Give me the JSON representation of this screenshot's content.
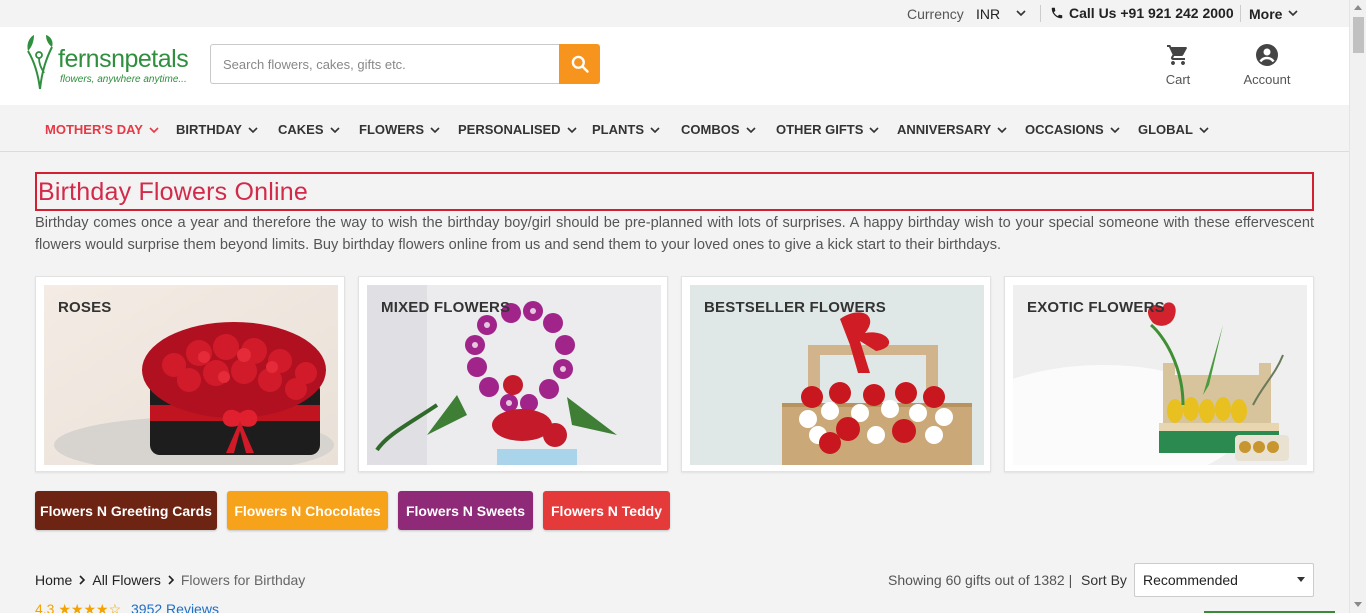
{
  "topbar": {
    "currency_label": "Currency",
    "currency_value": "INR",
    "call_label": "Call Us +91 921 242 2000",
    "more_label": "More"
  },
  "header": {
    "logo_text": "fernsnpetals",
    "logo_tagline": "flowers, anywhere anytime...",
    "search_placeholder": "Search flowers, cakes, gifts etc.",
    "cart_label": "Cart",
    "account_label": "Account",
    "search_icon": "search-icon",
    "cart_icon": "cart-icon",
    "account_icon": "account-icon"
  },
  "nav": {
    "items": [
      {
        "label": "MOTHER'S DAY",
        "active": true
      },
      {
        "label": "BIRTHDAY"
      },
      {
        "label": "CAKES"
      },
      {
        "label": "FLOWERS"
      },
      {
        "label": "PERSONALISED"
      },
      {
        "label": "PLANTS"
      },
      {
        "label": "COMBOS"
      },
      {
        "label": "OTHER GIFTS"
      },
      {
        "label": "ANNIVERSARY"
      },
      {
        "label": "OCCASIONS"
      },
      {
        "label": "GLOBAL"
      }
    ],
    "active_color": "#e53945"
  },
  "page": {
    "title": "Birthday Flowers Online",
    "description": "Birthday comes once a year and therefore the way to wish the birthday boy/girl should be pre-planned with lots of surprises. A happy birthday wish to your special someone with these effervescent flowers would surprise them beyond limits. Buy birthday flowers online from us and send them to your loved ones to give a kick start to their birthdays."
  },
  "categories": [
    {
      "label": "ROSES"
    },
    {
      "label": "MIXED FLOWERS"
    },
    {
      "label": "BESTSELLER FLOWERS"
    },
    {
      "label": "EXOTIC FLOWERS"
    }
  ],
  "chips": [
    {
      "label": "Flowers N Greeting Cards",
      "color": "#6d2413"
    },
    {
      "label": "Flowers N Chocolates",
      "color": "#f7a21b"
    },
    {
      "label": "Flowers N Sweets",
      "color": "#8e2a78"
    },
    {
      "label": "Flowers N Teddy",
      "color": "#e53a3a"
    }
  ],
  "breadcrumb": {
    "home": "Home",
    "all_flowers": "All Flowers",
    "current": "Flowers for Birthday"
  },
  "listing": {
    "showing": "Showing 60 gifts out of 1382 |",
    "sort_label": "Sort By",
    "sort_value": "Recommended"
  },
  "rating": {
    "value": "4.3",
    "stars": "★★★★☆",
    "reviews": "3952 Reviews"
  }
}
